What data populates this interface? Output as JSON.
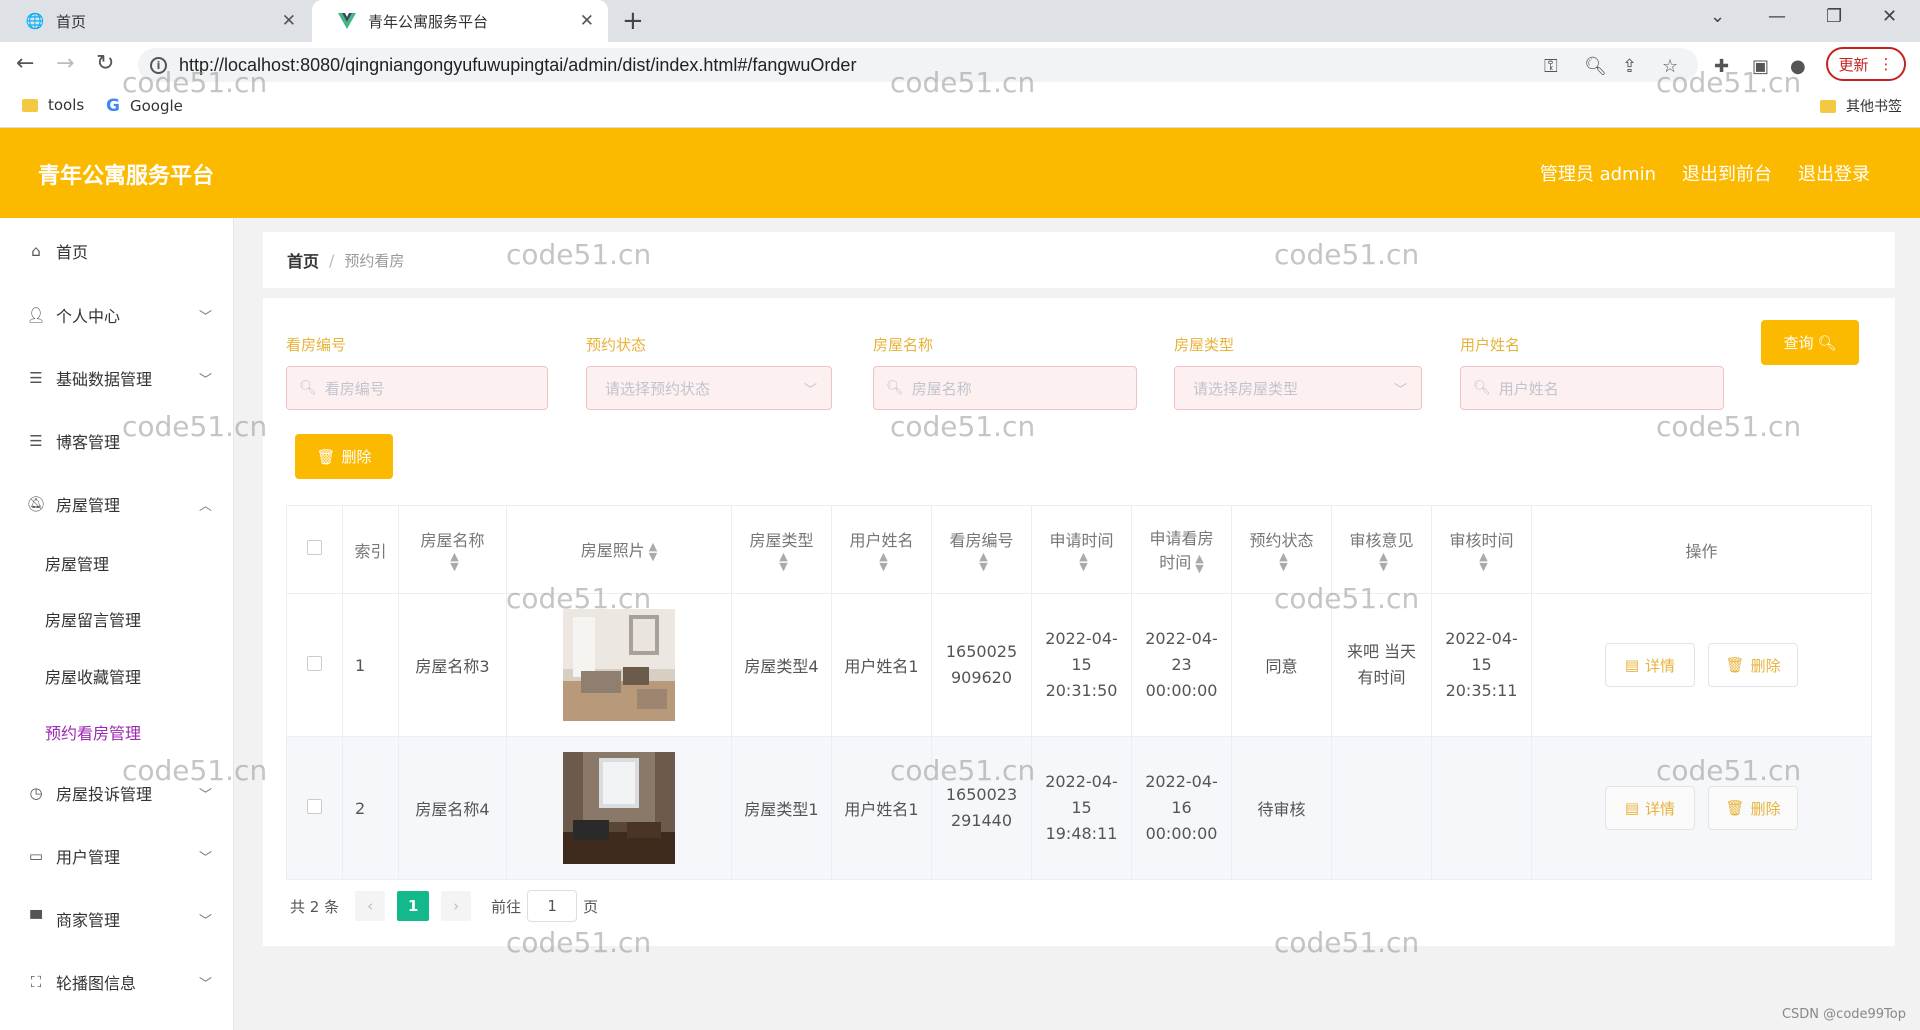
{
  "browser": {
    "tabs": [
      {
        "title": "首页",
        "active": false
      },
      {
        "title": "青年公寓服务平台",
        "active": true
      }
    ],
    "url": "http://localhost:8080/qingniangongyufuwupingtai/admin/dist/index.html#/fangwuOrder",
    "update_label": "更新",
    "bookmarks": [
      "tools",
      "Google"
    ],
    "other_bookmarks": "其他书签"
  },
  "header": {
    "title": "青年公寓服务平台",
    "links": [
      "管理员 admin",
      "退出到前台",
      "退出登录"
    ]
  },
  "sidebar": {
    "items": [
      {
        "label": "首页",
        "icon": "home-icon"
      },
      {
        "label": "个人中心",
        "icon": "user-icon"
      },
      {
        "label": "基础数据管理",
        "icon": "menu-icon"
      },
      {
        "label": "博客管理",
        "icon": "menu-icon"
      },
      {
        "label": "房屋管理",
        "icon": "bell-off-icon"
      },
      {
        "label": "房屋投诉管理",
        "icon": "clock-icon"
      },
      {
        "label": "用户管理",
        "icon": "chat-icon"
      },
      {
        "label": "商家管理",
        "icon": "shop-icon"
      },
      {
        "label": "轮播图信息",
        "icon": "fullscreen-icon"
      }
    ],
    "subitems": [
      "房屋管理",
      "房屋留言管理",
      "房屋收藏管理",
      "预约看房管理"
    ]
  },
  "breadcrumb": {
    "home": "首页",
    "current": "预约看房"
  },
  "filters": [
    {
      "label": "看房编号",
      "placeholder": "看房编号",
      "type": "input"
    },
    {
      "label": "预约状态",
      "placeholder": "请选择预约状态",
      "type": "select"
    },
    {
      "label": "房屋名称",
      "placeholder": "房屋名称",
      "type": "input"
    },
    {
      "label": "房屋类型",
      "placeholder": "请选择房屋类型",
      "type": "select"
    },
    {
      "label": "用户姓名",
      "placeholder": "用户姓名",
      "type": "input"
    }
  ],
  "buttons": {
    "query": "查询",
    "delete": "删除"
  },
  "table": {
    "headers": [
      "索引",
      "房屋名称",
      "房屋照片",
      "房屋类型",
      "用户姓名",
      "看房编号",
      "申请时间",
      "申请看房时间",
      "预约状态",
      "审核意见",
      "审核时间",
      "操作"
    ],
    "rows": [
      {
        "index": "1",
        "name": "房屋名称3",
        "type": "房屋类型4",
        "user": "用户姓名1",
        "code": "1650025909620",
        "apply_time": "2022-04-15 20:31:50",
        "view_time": "2022-04-23 00:00:00",
        "status": "同意",
        "opinion": "来吧 当天有时间",
        "review_time": "2022-04-15 20:35:11"
      },
      {
        "index": "2",
        "name": "房屋名称4",
        "type": "房屋类型1",
        "user": "用户姓名1",
        "code": "1650023291440",
        "apply_time": "2022-04-15 19:48:11",
        "view_time": "2022-04-16 00:00:00",
        "status": "待审核",
        "opinion": "",
        "review_time": ""
      }
    ],
    "actions": {
      "detail": "详情",
      "delete": "删除"
    }
  },
  "pagination": {
    "total": "共 2 条",
    "current": "1",
    "goto_prefix": "前往",
    "goto_value": "1",
    "goto_suffix": "页"
  },
  "watermark": "code51.cn",
  "credit": "CSDN @code99Top"
}
